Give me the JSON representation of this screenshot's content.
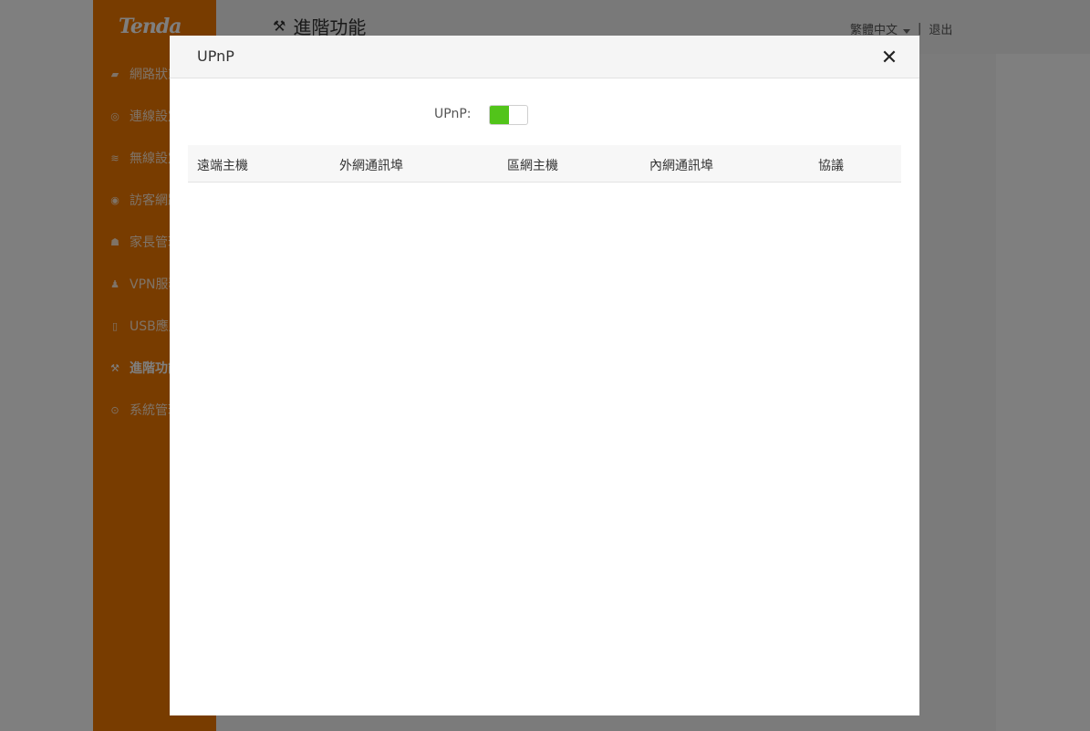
{
  "brand": {
    "logo": "Tenda"
  },
  "sidebar": {
    "items": [
      {
        "label": "網路狀態",
        "icon": "router-icon"
      },
      {
        "label": "連線設定",
        "icon": "globe-icon"
      },
      {
        "label": "無線設定",
        "icon": "wifi-icon"
      },
      {
        "label": "訪客網路",
        "icon": "location-icon"
      },
      {
        "label": "家長管理",
        "icon": "parental-icon"
      },
      {
        "label": "VPN服務",
        "icon": "vpn-icon"
      },
      {
        "label": "USB應用",
        "icon": "usb-icon"
      },
      {
        "label": "進階功能",
        "icon": "wrench-icon",
        "active": true
      },
      {
        "label": "系統管理",
        "icon": "settings-icon"
      }
    ]
  },
  "header": {
    "title": "進階功能",
    "language": "繁體中文",
    "separator": "|",
    "logout": "退出"
  },
  "modal": {
    "title": "UPnP",
    "upnp_label": "UPnP:",
    "upnp_enabled": true,
    "columns": [
      "遠端主機",
      "外網通訊埠",
      "區網主機",
      "內網通訊埠",
      "協議"
    ],
    "rows": []
  },
  "colors": {
    "sidebar": "#f07800",
    "toggle_on": "#52c41a"
  }
}
